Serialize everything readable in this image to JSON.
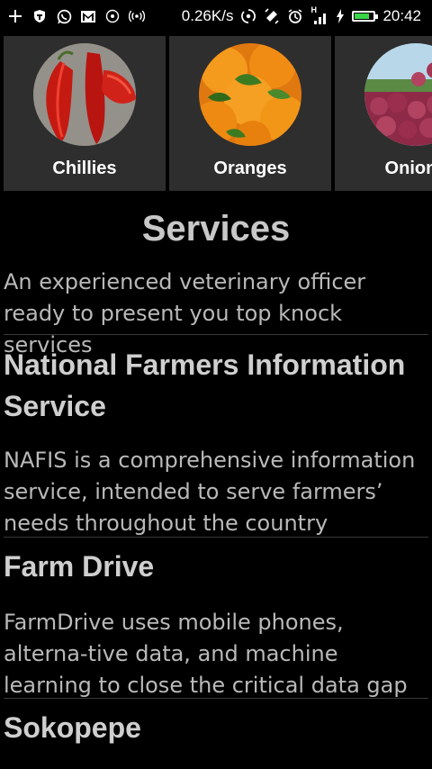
{
  "status_bar": {
    "network_speed": "0.26K/s",
    "time": "20:42",
    "signal_type": "H"
  },
  "categories": [
    {
      "label": "Chillies"
    },
    {
      "label": "Oranges"
    },
    {
      "label": "Onions"
    }
  ],
  "services": {
    "title": "Services",
    "intro": "An experienced veterinary officer ready to present you top knock services",
    "items": [
      {
        "title": "National Farmers Information Service",
        "description": "NAFIS is a comprehensive information service, intended to serve farmers’ needs throughout the country including"
      },
      {
        "title": "Farm Drive",
        "description": "FarmDrive uses mobile phones, alterna-tive data, and machine learning to close the critical data gap that prevents"
      },
      {
        "title": "Sokopepe",
        "description": ""
      }
    ]
  }
}
